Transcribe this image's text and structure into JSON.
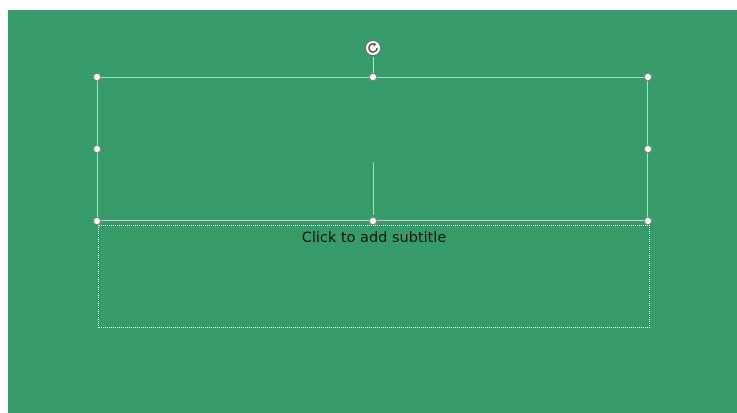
{
  "slide": {
    "background_color": "#369a69",
    "subtitle_placeholder": "Click to add subtitle",
    "rotate_icon": "rotate-icon"
  }
}
